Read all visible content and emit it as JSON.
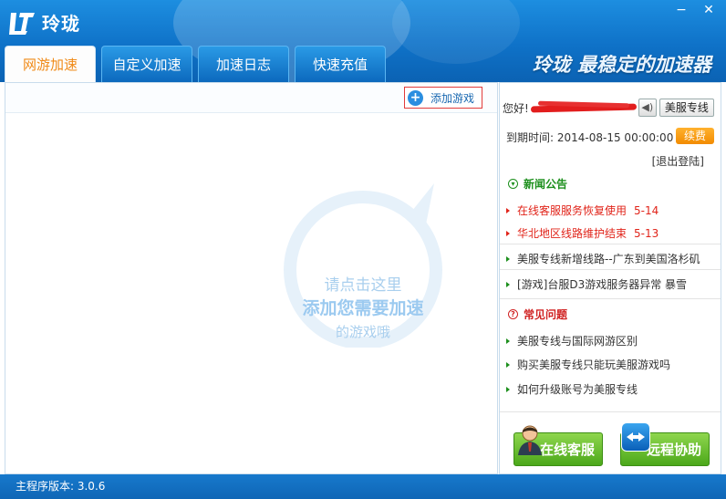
{
  "app": {
    "name": "玲珑",
    "slogan": "玲珑 最稳定的加速器"
  },
  "window": {
    "minimize": "−",
    "close": "✕"
  },
  "tabs": [
    {
      "label": "网游加速",
      "active": true
    },
    {
      "label": "自定义加速",
      "active": false
    },
    {
      "label": "加速日志",
      "active": false
    },
    {
      "label": "快速充值",
      "active": false
    }
  ],
  "main": {
    "add_game_label": "添加游戏",
    "hint_line1": "请点击这里",
    "hint_line2": "添加您需要加速",
    "hint_line3": "的游戏哦"
  },
  "account": {
    "greeting": "您好!",
    "line_button": "美服专线",
    "expiry_label": "到期时间:",
    "expiry_value": "2014-08-15 00:00:00",
    "renew": "续费",
    "logout": "[退出登陆]"
  },
  "news": {
    "title": "新闻公告",
    "items": [
      {
        "text": "在线客服服务恢复使用",
        "date": "5-14"
      },
      {
        "text": "华北地区线路维护结束",
        "date": "5-13"
      },
      {
        "text": "美服专线新增线路--广东到美国洛杉矶",
        "date": ""
      },
      {
        "text": "[游戏]台服D3游戏服务器异常 暴雪",
        "date": ""
      }
    ]
  },
  "faq": {
    "title": "常见问题",
    "items": [
      {
        "text": "美服专线与国际网游区别"
      },
      {
        "text": "购买美服专线只能玩美服游戏吗"
      },
      {
        "text": "如何升级账号为美服专线"
      }
    ]
  },
  "support": {
    "online_service": "在线客服",
    "remote_assist": "远程协助"
  },
  "status": {
    "version_label": "主程序版本: 3.0.6"
  },
  "colors": {
    "header_blue": "#0f72c8",
    "accent_orange": "#f08a17",
    "news_green": "#1c8f1c",
    "alert_red": "#e1241a"
  }
}
